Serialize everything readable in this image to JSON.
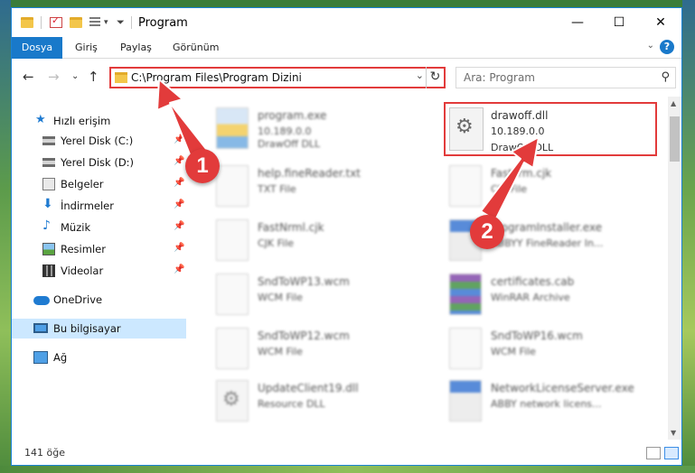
{
  "window": {
    "title": "Program"
  },
  "ribbon": {
    "tabs": [
      "Dosya",
      "Giriş",
      "Paylaş",
      "Görünüm"
    ]
  },
  "nav": {
    "address": "C:\\Program Files\\Program Dizini",
    "search_placeholder": "Ara: Program"
  },
  "sidebar": {
    "quick_access": "Hızlı erişim",
    "items": [
      {
        "label": "Yerel Disk (C:)",
        "icon": "drive-icon"
      },
      {
        "label": "Yerel Disk (D:)",
        "icon": "drive-icon"
      },
      {
        "label": "Belgeler",
        "icon": "documents-icon"
      },
      {
        "label": "İndirmeler",
        "icon": "downloads-icon"
      },
      {
        "label": "Müzik",
        "icon": "music-icon"
      },
      {
        "label": "Resimler",
        "icon": "pictures-icon"
      },
      {
        "label": "Videolar",
        "icon": "videos-icon"
      }
    ],
    "onedrive": "OneDrive",
    "this_pc": "Bu bilgisayar",
    "network": "Ağ"
  },
  "files": [
    {
      "name": "program.exe",
      "meta1": "10.189.0.0",
      "meta2": "DrawOff DLL",
      "icon": "exe-icon"
    },
    {
      "name": "drawoff.dll",
      "meta1": "10.189.0.0",
      "meta2": "DrawOff DLL",
      "icon": "dll-gear-icon"
    },
    {
      "name": "help.fineReader.txt",
      "meta1": "TXT File",
      "icon": "file-icon"
    },
    {
      "name": "FastFrm.cjk",
      "meta1": "CJK File",
      "icon": "file-icon"
    },
    {
      "name": "FastNrml.cjk",
      "meta1": "CJK File",
      "icon": "file-icon"
    },
    {
      "name": "ProgramInstaller.exe",
      "meta1": "ABBYY FineReader In...",
      "icon": "installer-icon"
    },
    {
      "name": "SndToWP13.wcm",
      "meta1": "WCM File",
      "icon": "file-icon"
    },
    {
      "name": "certificates.cab",
      "meta1": "WinRAR Archive",
      "icon": "rar-icon"
    },
    {
      "name": "SndToWP12.wcm",
      "meta1": "WCM File",
      "icon": "file-icon"
    },
    {
      "name": "SndToWP16.wcm",
      "meta1": "WCM File",
      "icon": "file-icon"
    },
    {
      "name": "UpdateClient19.dll",
      "meta1": "Resource DLL",
      "icon": "dll-gear-icon"
    },
    {
      "name": "NetworkLicenseServer.exe",
      "meta1": "ABBY network licens...",
      "icon": "installer-icon"
    }
  ],
  "status": {
    "count": "141 öğe"
  },
  "annotations": {
    "callout1": "1",
    "callout2": "2",
    "accent": "#e23b3b"
  }
}
